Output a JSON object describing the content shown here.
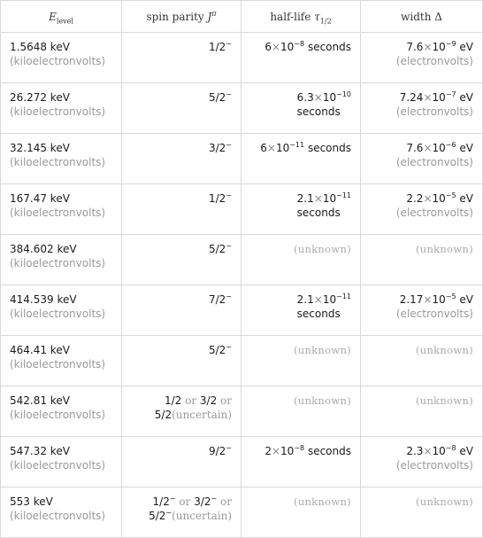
{
  "table": {
    "headers": {
      "energy": {
        "symbol": "E",
        "subscript": "level"
      },
      "spin": {
        "label": "spin parity ",
        "symbol": "J",
        "superscript": "π"
      },
      "halflife": {
        "label": "half-life ",
        "symbol": "τ",
        "subscript": "1/2"
      },
      "width": {
        "label": "width Δ"
      }
    },
    "rows": [
      {
        "energy": {
          "value": "1.5648 keV",
          "unit": "(kiloelectronvolts)"
        },
        "spin": {
          "value": "1/2",
          "parity": "−"
        },
        "halflife": {
          "mantissa": "6",
          "exponent": "−8",
          "unit": "seconds",
          "wrap": false
        },
        "width": {
          "mantissa": "7.6",
          "exponent": "−9",
          "unit": "eV",
          "unit_name": "(electronvolts)"
        }
      },
      {
        "energy": {
          "value": "26.272 keV",
          "unit": "(kiloelectronvolts)"
        },
        "spin": {
          "value": "5/2",
          "parity": "−"
        },
        "halflife": {
          "mantissa": "6.3",
          "exponent": "−10",
          "unit": "seconds",
          "wrap": true
        },
        "width": {
          "mantissa": "7.24",
          "exponent": "−7",
          "unit": "eV",
          "unit_name": "(electronvolts)"
        }
      },
      {
        "energy": {
          "value": "32.145 keV",
          "unit": "(kiloelectronvolts)"
        },
        "spin": {
          "value": "3/2",
          "parity": "−"
        },
        "halflife": {
          "mantissa": "6",
          "exponent": "−11",
          "unit": "seconds",
          "wrap": false
        },
        "width": {
          "mantissa": "7.6",
          "exponent": "−6",
          "unit": "eV",
          "unit_name": "(electronvolts)"
        }
      },
      {
        "energy": {
          "value": "167.47 keV",
          "unit": "(kiloelectronvolts)"
        },
        "spin": {
          "value": "1/2",
          "parity": "−"
        },
        "halflife": {
          "mantissa": "2.1",
          "exponent": "−11",
          "unit": "seconds",
          "wrap": true
        },
        "width": {
          "mantissa": "2.2",
          "exponent": "−5",
          "unit": "eV",
          "unit_name": "(electronvolts)"
        }
      },
      {
        "energy": {
          "value": "384.602 keV",
          "unit": "(kiloelectronvolts)"
        },
        "spin": {
          "value": "5/2",
          "parity": "−"
        },
        "halflife": {
          "unknown": "(unknown)"
        },
        "width": {
          "unknown": "(unknown)"
        }
      },
      {
        "energy": {
          "value": "414.539 keV",
          "unit": "(kiloelectronvolts)"
        },
        "spin": {
          "value": "7/2",
          "parity": "−"
        },
        "halflife": {
          "mantissa": "2.1",
          "exponent": "−11",
          "unit": "seconds",
          "wrap": true
        },
        "width": {
          "mantissa": "2.17",
          "exponent": "−5",
          "unit": "eV",
          "unit_name": "(electronvolts)"
        }
      },
      {
        "energy": {
          "value": "464.41 keV",
          "unit": "(kiloelectronvolts)"
        },
        "spin": {
          "value": "5/2",
          "parity": "−"
        },
        "halflife": {
          "unknown": "(unknown)"
        },
        "width": {
          "unknown": "(unknown)"
        }
      },
      {
        "energy": {
          "value": "542.81 keV",
          "unit": "(kiloelectronvolts)"
        },
        "spin": {
          "options": [
            "1/2",
            "3/2",
            "5/2"
          ],
          "parity": "",
          "or": "or",
          "uncertain": "(uncertain)"
        },
        "halflife": {
          "unknown": "(unknown)"
        },
        "width": {
          "unknown": "(unknown)"
        }
      },
      {
        "energy": {
          "value": "547.32 keV",
          "unit": "(kiloelectronvolts)"
        },
        "spin": {
          "value": "9/2",
          "parity": "−"
        },
        "halflife": {
          "mantissa": "2",
          "exponent": "−8",
          "unit": "seconds",
          "wrap": false
        },
        "width": {
          "mantissa": "2.3",
          "exponent": "−8",
          "unit": "eV",
          "unit_name": "(electronvolts)"
        }
      },
      {
        "energy": {
          "value": "553 keV",
          "unit": "(kiloelectronvolts)"
        },
        "spin": {
          "options": [
            "1/2",
            "3/2",
            "5/2"
          ],
          "parity": "−",
          "or": "or",
          "uncertain": "(uncertain)"
        },
        "halflife": {
          "unknown": "(unknown)"
        },
        "width": {
          "unknown": "(unknown)"
        }
      }
    ],
    "times_symbol": "×",
    "base": "10"
  }
}
